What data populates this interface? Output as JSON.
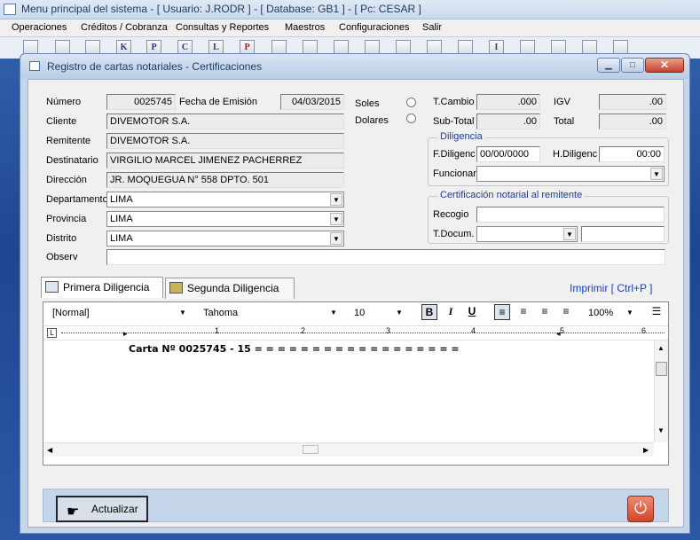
{
  "main": {
    "title": "Menu principal del sistema - [ Usuario: J.RODR ] - [ Database: GB1 ] - [ Pc: CESAR ]",
    "menu": [
      "Operaciones",
      "Créditos / Cobranza",
      "Consultas y Reportes",
      "Maestros",
      "Configuraciones",
      "Salir"
    ],
    "toolbar_letters": [
      "K",
      "P",
      "C",
      "L",
      "P",
      "I"
    ]
  },
  "dialog": {
    "title": "Registro de cartas notariales - Certificaciones",
    "fields": {
      "numero_label": "Número",
      "numero": "0025745",
      "fecha_label": "Fecha de Emisión",
      "fecha": "04/03/2015",
      "cliente_label": "Cliente",
      "cliente": "DIVEMOTOR S.A.",
      "remitente_label": "Remitente",
      "remitente": "DIVEMOTOR S.A.",
      "destinatario_label": "Destinatario",
      "destinatario": "VIRGILIO MARCEL JIMENEZ PACHERREZ",
      "direccion_label": "Dirección",
      "direccion": "JR. MOQUEGUA N° 558 DPTO. 501",
      "departamento_label": "Departamento",
      "departamento": "LIMA",
      "provincia_label": "Provincia",
      "provincia": "LIMA",
      "distrito_label": "Distrito",
      "distrito": "LIMA",
      "observ_label": "Observ",
      "observ": ""
    },
    "currency": {
      "soles": "Soles",
      "dolares": "Dolares"
    },
    "totals": {
      "tcambio_label": "T.Cambio",
      "tcambio": ".000",
      "igv_label": "IGV",
      "igv": ".00",
      "subtotal_label": "Sub-Total",
      "subtotal": ".00",
      "total_label": "Total",
      "total": ".00"
    },
    "diligencia": {
      "caption": "Diligencia",
      "fdiligenc_label": "F.Diligenc",
      "fdiligenc": "00/00/0000",
      "hdiligenc_label": "H.Diligenc",
      "hdiligenc": "00:00",
      "funcionar_label": "Funcionar"
    },
    "certificacion": {
      "caption": "Certificación notarial al remitente",
      "recogio_label": "Recogio",
      "tdocum_label": "T.Docum."
    },
    "tabs": [
      "Primera Diligencia",
      "Segunda Diligencia"
    ],
    "print_link": "Imprimir [ Ctrl+P ]",
    "editor": {
      "style": "[Normal]",
      "font": "Tahoma",
      "size": "10",
      "zoom": "100%",
      "content": "Carta Nº 0025745 - 15 = = = = = = = = = = = = = = = = = =",
      "ruler_marks": [
        "1",
        "2",
        "3",
        "4",
        "5",
        "6"
      ]
    },
    "actualizar": "Actualizar"
  }
}
